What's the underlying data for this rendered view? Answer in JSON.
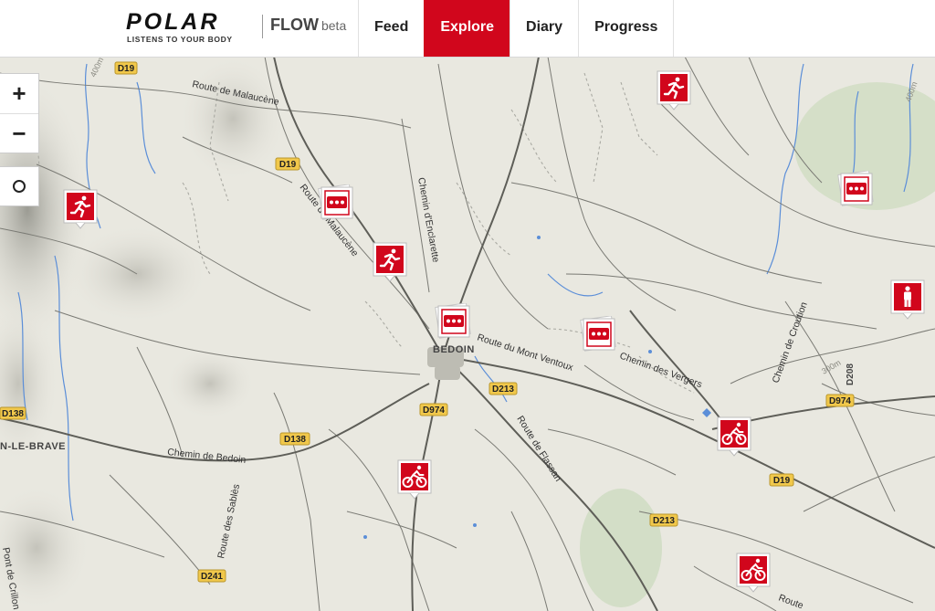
{
  "brand": {
    "logo_text": "POLAR",
    "tagline": "LISTENS TO YOUR BODY",
    "product": "FLOW",
    "product_suffix": "beta"
  },
  "nav": {
    "tabs": [
      {
        "label": "Feed",
        "active": false
      },
      {
        "label": "Explore",
        "active": true
      },
      {
        "label": "Diary",
        "active": false
      },
      {
        "label": "Progress",
        "active": false
      }
    ]
  },
  "map_controls": {
    "zoom_in": "+",
    "zoom_out": "−",
    "locate": "locate"
  },
  "map": {
    "roads": [
      {
        "label": "Route de Malaucène"
      },
      {
        "label": "Route de Malaucène"
      },
      {
        "label": "Chemin d'Enclarette"
      },
      {
        "label": "Route du Mont Ventoux"
      },
      {
        "label": "Chemin des Vergers"
      },
      {
        "label": "Chemin de Croution"
      },
      {
        "label": "Route de Flassan"
      },
      {
        "label": "Chemin de Bedoin"
      },
      {
        "label": "Route des Sablès"
      },
      {
        "label": "Route"
      },
      {
        "label": "Pont de Crillon"
      }
    ],
    "places": [
      {
        "label": "BEDOIN"
      },
      {
        "label": "N-LE-BRAVE"
      }
    ],
    "shields": [
      {
        "label": "D19"
      },
      {
        "label": "D19"
      },
      {
        "label": "D19"
      },
      {
        "label": "D138"
      },
      {
        "label": "D138"
      },
      {
        "label": "D974"
      },
      {
        "label": "D974"
      },
      {
        "label": "D213"
      },
      {
        "label": "D213"
      },
      {
        "label": "D241"
      },
      {
        "label": "D208"
      }
    ],
    "contours": [
      {
        "label": "400m"
      },
      {
        "label": "400m"
      },
      {
        "label": "300m"
      }
    ]
  },
  "markers": [
    {
      "type": "running"
    },
    {
      "type": "running"
    },
    {
      "type": "running"
    },
    {
      "type": "multi"
    },
    {
      "type": "multi"
    },
    {
      "type": "multi"
    },
    {
      "type": "multi"
    },
    {
      "type": "other"
    },
    {
      "type": "cycling"
    },
    {
      "type": "cycling"
    },
    {
      "type": "cycling"
    }
  ],
  "colors": {
    "accent": "#d1061c",
    "map_bg": "#e9e8e0",
    "road": "#6f6f6f",
    "water": "#5b8ed8",
    "shield": "#f1c84b"
  }
}
